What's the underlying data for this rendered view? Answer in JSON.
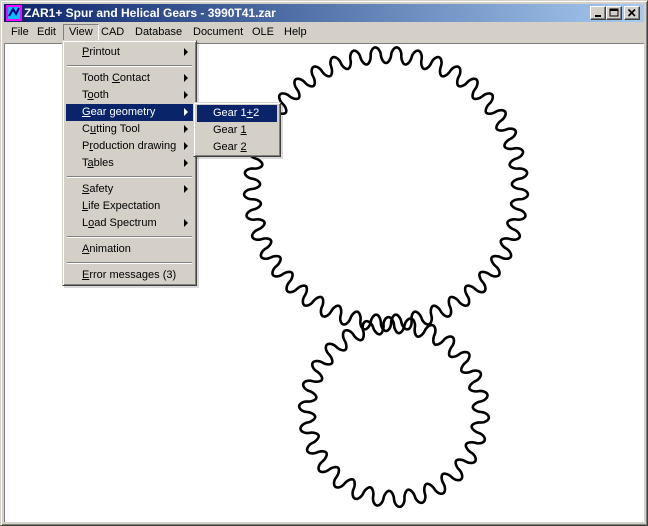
{
  "window": {
    "title": "ZAR1+  Spur and Helical Gears  -  3990T41.zar",
    "icon": "zar-app-icon",
    "buttons": [
      "minimize-icon",
      "maximize-icon",
      "close-icon"
    ]
  },
  "menubar": [
    {
      "id": "file",
      "label": "File"
    },
    {
      "id": "edit",
      "label": "Edit"
    },
    {
      "id": "view",
      "label": "View"
    },
    {
      "id": "cad",
      "label": "CAD"
    },
    {
      "id": "database",
      "label": "Database"
    },
    {
      "id": "document",
      "label": "Document"
    },
    {
      "id": "ole",
      "label": "OLE"
    },
    {
      "id": "help",
      "label": "Help"
    }
  ],
  "view_menu": {
    "items": [
      {
        "id": "printout",
        "pre": "",
        "mn": "P",
        "post": "rintout",
        "submenu": true
      },
      {
        "id": "tooth-contact",
        "pre": "Tooth ",
        "mn": "C",
        "post": "ontact",
        "submenu": true
      },
      {
        "id": "tooth",
        "pre": "T",
        "mn": "o",
        "post": "oth",
        "submenu": true
      },
      {
        "id": "gear-geometry",
        "pre": "",
        "mn": "G",
        "post": "ear geometry",
        "submenu": true,
        "selected": true
      },
      {
        "id": "cutting-tool",
        "pre": "C",
        "mn": "u",
        "post": "tting Tool",
        "submenu": true
      },
      {
        "id": "production-drawing",
        "pre": "P",
        "mn": "r",
        "post": "oduction drawing",
        "submenu": true
      },
      {
        "id": "tables",
        "pre": "T",
        "mn": "a",
        "post": "bles",
        "submenu": true
      },
      {
        "id": "safety",
        "pre": "",
        "mn": "S",
        "post": "afety",
        "submenu": true
      },
      {
        "id": "life-expectation",
        "pre": "",
        "mn": "L",
        "post": "ife Expectation",
        "submenu": false
      },
      {
        "id": "load-spectrum",
        "pre": "L",
        "mn": "o",
        "post": "ad Spectrum",
        "submenu": true
      },
      {
        "id": "animation",
        "pre": "",
        "mn": "A",
        "post": "nimation",
        "submenu": false
      },
      {
        "id": "error-messages",
        "pre": "",
        "mn": "E",
        "post": "rror messages (3)",
        "submenu": false
      }
    ]
  },
  "gear_geometry_submenu": {
    "items": [
      {
        "id": "gear-1-2",
        "pre": "Gear 1",
        "mn": "+",
        "post": "2",
        "selected": true
      },
      {
        "id": "gear-1",
        "pre": "Gear ",
        "mn": "1",
        "post": ""
      },
      {
        "id": "gear-2",
        "pre": "Gear ",
        "mn": "2",
        "post": ""
      }
    ]
  },
  "drawing": {
    "gear_1_teeth": 41,
    "gear_2_teeth": 26,
    "stroke_color": "#000000"
  },
  "colors": {
    "titlebar_start": "#0a246a",
    "titlebar_end": "#a6caf0",
    "menu_highlight": "#0a246a",
    "face": "#d4d0c8"
  }
}
